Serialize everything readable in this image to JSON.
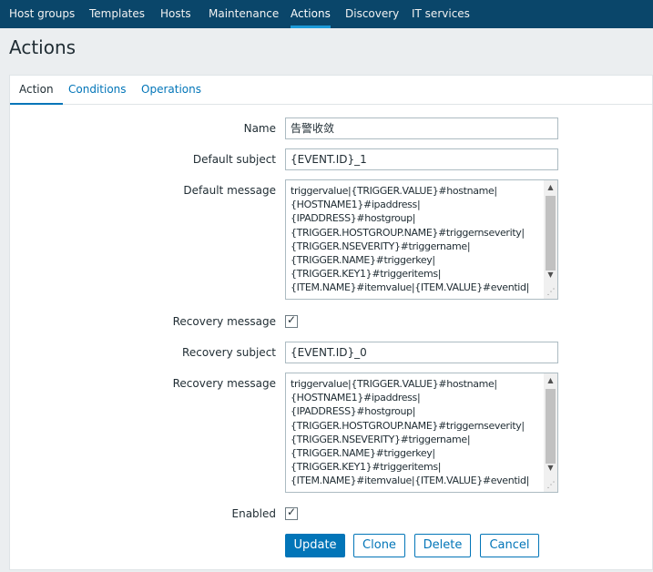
{
  "topnav": {
    "items": [
      {
        "label": "Host groups"
      },
      {
        "label": "Templates"
      },
      {
        "label": "Hosts"
      },
      {
        "label": "Maintenance"
      },
      {
        "label": "Actions"
      },
      {
        "label": "Discovery"
      },
      {
        "label": "IT services"
      }
    ],
    "active": "Actions"
  },
  "page": {
    "title": "Actions"
  },
  "tabs": [
    {
      "label": "Action"
    },
    {
      "label": "Conditions"
    },
    {
      "label": "Operations"
    }
  ],
  "form": {
    "name_label": "Name",
    "name_value": "告警收敛",
    "default_subject_label": "Default subject",
    "default_subject_value": "{EVENT.ID}_1",
    "default_message_label": "Default message",
    "default_message_value": "triggervalue|{TRIGGER.VALUE}#hostname|\n{HOSTNAME1}#ipaddress|\n{IPADDRESS}#hostgroup|\n{TRIGGER.HOSTGROUP.NAME}#triggernseverity|\n{TRIGGER.NSEVERITY}#triggername|\n{TRIGGER.NAME}#triggerkey|\n{TRIGGER.KEY1}#triggeritems|\n{ITEM.NAME}#itemvalue|{ITEM.VALUE}#eventid|",
    "recovery_message_checkbox_label": "Recovery message",
    "recovery_message_checked": true,
    "recovery_subject_label": "Recovery subject",
    "recovery_subject_value": "{EVENT.ID}_0",
    "recovery_message_label": "Recovery message",
    "recovery_message_value": "triggervalue|{TRIGGER.VALUE}#hostname|\n{HOSTNAME1}#ipaddress|\n{IPADDRESS}#hostgroup|\n{TRIGGER.HOSTGROUP.NAME}#triggernseverity|\n{TRIGGER.NSEVERITY}#triggername|\n{TRIGGER.NAME}#triggerkey|\n{TRIGGER.KEY1}#triggeritems|\n{ITEM.NAME}#itemvalue|{ITEM.VALUE}#eventid|",
    "enabled_label": "Enabled",
    "enabled_checked": true
  },
  "buttons": {
    "update": "Update",
    "clone": "Clone",
    "delete": "Delete",
    "cancel": "Cancel"
  },
  "icons": {
    "checkmark": "check-icon",
    "scroll_up": "chevron-up-icon",
    "scroll_down": "chevron-down-icon",
    "resize": "resize-grip-icon"
  },
  "colors": {
    "nav_background": "#0a466a",
    "accent": "#0275b8",
    "active_tab_underline": "#1c9ad8"
  }
}
